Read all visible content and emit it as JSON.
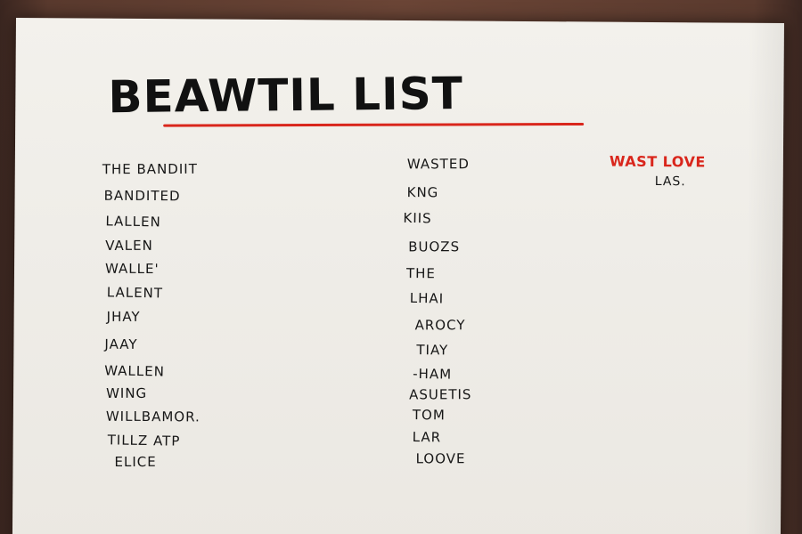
{
  "title": "BEAWTIL LIST",
  "left_column": [
    "THE BANDIIT",
    "BANDITED",
    "LALLEN",
    "VALEN",
    "WALLE'",
    "LALENT",
    "JHAY",
    "JAAY",
    "WALLEN",
    "WING",
    "WILLBAMOR.",
    "TILLZ ATP",
    "ELICE"
  ],
  "right_column": [
    "WASTED",
    "KNG",
    "KIIS",
    "BUOZS",
    "THE",
    "LHAI",
    "AROCY",
    "TIAY",
    "-HAM",
    "ASUETIS",
    "TOM",
    "LAR",
    "LOOVE"
  ],
  "side_note": {
    "heading": "WAST LOVE",
    "sub": "LAS."
  },
  "colors": {
    "ink": "#161616",
    "accent_red": "#d9261c",
    "paper": "#efede8",
    "wood": "#6b4536"
  }
}
